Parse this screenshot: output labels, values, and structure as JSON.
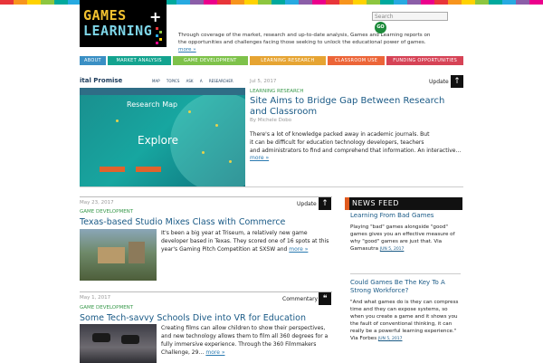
{
  "stripe_colors": [
    "#e8353a",
    "#f7941d",
    "#ffd200",
    "#8dc63f",
    "#00a99d",
    "#27aae1",
    "#8b5ea8",
    "#ec008c",
    "#e8353a",
    "#f7941d",
    "#ffd200",
    "#8dc63f",
    "#00a99d",
    "#27aae1",
    "#8b5ea8",
    "#ec008c",
    "#e8353a",
    "#f7941d",
    "#ffd200",
    "#8dc63f",
    "#00a99d",
    "#27aae1",
    "#8b5ea8",
    "#ec008c",
    "#e8353a",
    "#f7941d",
    "#ffd200",
    "#8dc63f",
    "#00a99d",
    "#27aae1",
    "#8b5ea8",
    "#ec008c",
    "#e8353a",
    "#f7941d",
    "#ffd200",
    "#8dc63f",
    "#00a99d",
    "#27aae1",
    "#8b5ea8",
    "#ec008c"
  ],
  "logo": {
    "line1": "GAMES",
    "plus": "+",
    "line2": "LEARNING"
  },
  "header": {
    "tagline": "Through coverage of the market, research and up-to-date analysis, Games and Learning reports on the opportunities and challenges facing those seeking to unlock the educational power of games.",
    "tagline_more": "more »",
    "search_placeholder": "Search",
    "go_label": "GO"
  },
  "nav": [
    {
      "label": "ABOUT",
      "color": "#3a8fc4",
      "width": 29
    },
    {
      "label": "MARKET ANALYSIS",
      "color": "#13a38f",
      "width": 70
    },
    {
      "label": "GAME DEVELOPMENT",
      "color": "#7ec24a",
      "width": 84
    },
    {
      "label": "LEARNING RESEARCH",
      "color": "#e6a432",
      "width": 84
    },
    {
      "label": "CLASSROOM USE",
      "color": "#ec6538",
      "width": 64
    },
    {
      "label": "FUNDING OPPORTUNITIES",
      "color": "#d64356",
      "width": 85
    }
  ],
  "hero": {
    "image": {
      "brand": "ital Promise",
      "links": "MAP TOPICS ASK A RESEARCHER",
      "label": "Research Map",
      "cta": "Explore"
    },
    "date": "Jul 5, 2017",
    "type": "Update",
    "category": "LEARNING RESEARCH",
    "title": "Site Aims to Bridge Gap Between Research and Classroom",
    "byline": "By Michele Dobo",
    "body1": "There's a lot of knowledge packed away in academic journals. But",
    "body2": "it can be difficult for education technology developers, teachers",
    "body3": "and administrators to find and comprehend that information. An interactive…",
    "more": "more »"
  },
  "articles": [
    {
      "date": "May 23, 2017",
      "type": "Update",
      "category": "GAME DEVELOPMENT",
      "title": "Texas-based Studio Mixes Class with Commerce",
      "body": "It's been a big year at Triseum, a relatively new game developer based in Texas. They scored one of 16 spots at this year's Gaming Pitch Competition at SXSW and",
      "more": "more »"
    },
    {
      "date": "May 1, 2017",
      "type": "Commentary",
      "category": "GAME DEVELOPMENT",
      "title": "Some Tech-savvy Schools Dive into VR for Education",
      "body": "Creating films can allow children to show their perspectives, and new technology allows them to film all 360 degrees for a fully immersive experience. Through the 360 Filmmakers Challenge, 29…",
      "more": "more »"
    }
  ],
  "newsfeed": {
    "heading": "NEWS FEED",
    "items": [
      {
        "title": "Learning From Bad Games",
        "body": "Playing \"bad\" games alongside \"good\" games gives you an effective measure of why \"good\" games are just that. Via Gamasutra",
        "date": "JUN 5, 2017"
      },
      {
        "title": "Could Games Be The Key To A Strong Workforce?",
        "body": "\"And what games do is they can compress time and they can expose systems, so when you create a game and it shows you the fault of conventional thinking, it can really be a powerful learning experience.\" Via Forbes",
        "date": "JUN 5, 2017"
      }
    ]
  }
}
